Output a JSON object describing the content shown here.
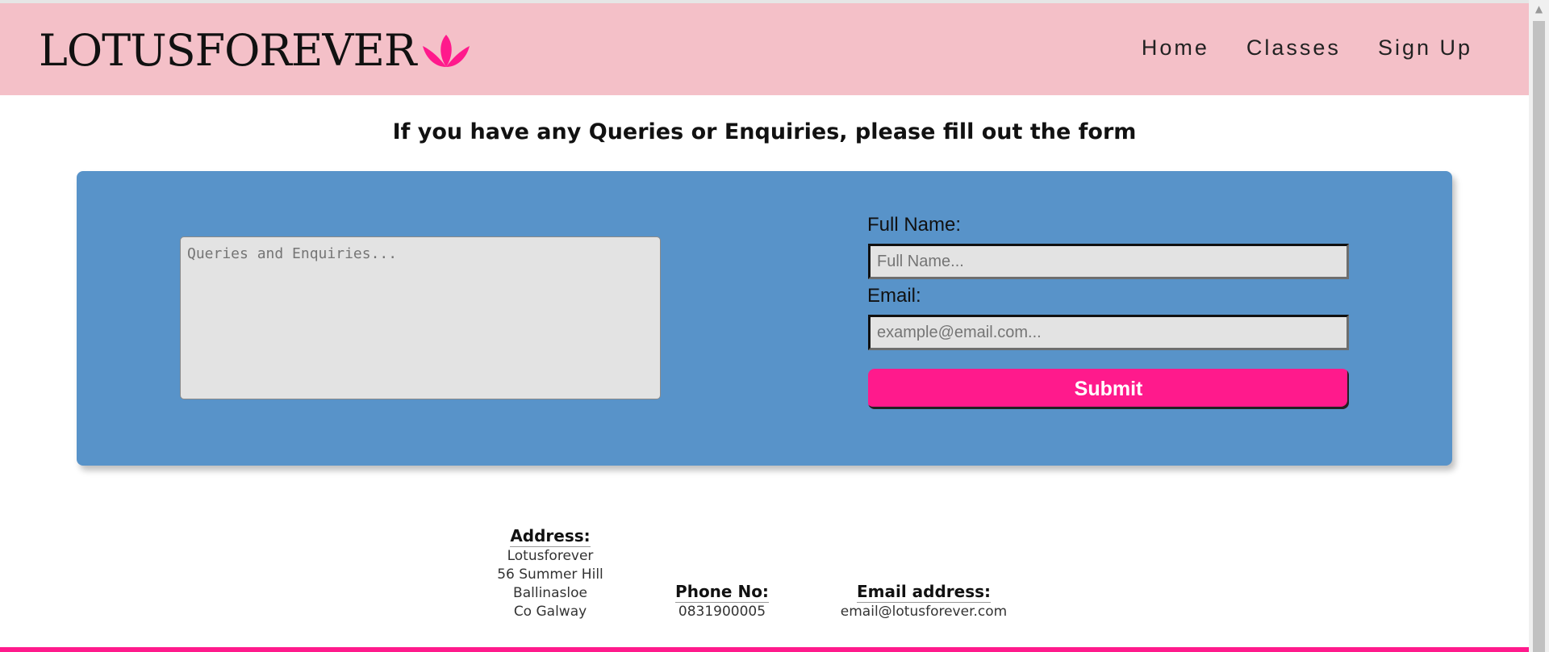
{
  "header": {
    "logo_text": "LOTUSFOREVER",
    "nav": [
      "Home",
      "Classes",
      "Sign Up"
    ]
  },
  "main": {
    "heading": "If you have any Queries or Enquiries, please fill out the form"
  },
  "form": {
    "queries_placeholder": "Queries and Enquiries...",
    "name_label": "Full Name:",
    "name_placeholder": "Full Name...",
    "email_label": "Email:",
    "email_placeholder": "example@email.com...",
    "submit_label": "Submit"
  },
  "contact": {
    "address_title": "Address:",
    "address_lines": [
      "Lotusforever",
      "56 Summer Hill",
      "Ballinasloe",
      "Co Galway"
    ],
    "phone_title": "Phone No:",
    "phone": "0831900005",
    "email_title": "Email address:",
    "email": "email@lotusforever.com"
  },
  "colors": {
    "header_bg": "#f4c0c8",
    "panel_bg": "#5893c9",
    "accent": "#ff1a8c"
  },
  "icons": {
    "logo": "lotus-icon",
    "scroll_up": "chevron-up-icon"
  }
}
